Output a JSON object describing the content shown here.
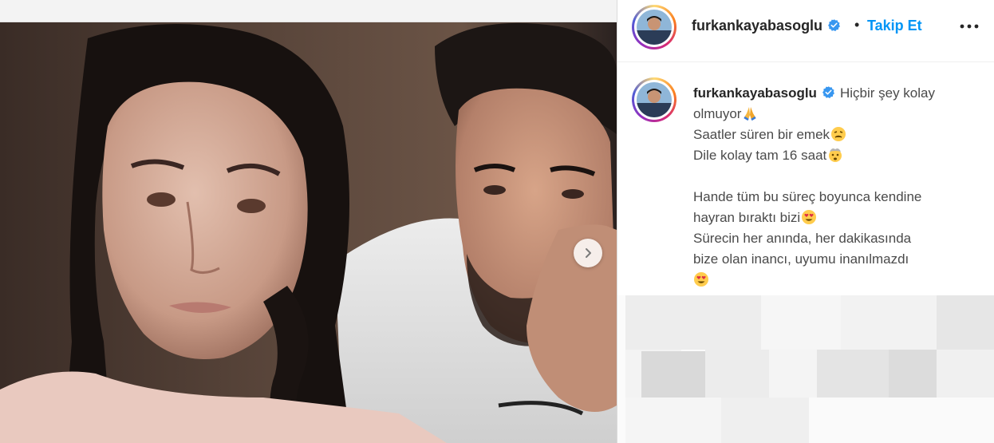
{
  "post": {
    "username": "furkankayabasoglu",
    "verified": true,
    "separator": "•",
    "follow_label": "Takip Et",
    "more_icon": "more-options-icon"
  },
  "caption": {
    "username": "furkankayabasoglu",
    "line1_text": "Hiçbir şey kolay",
    "line2_text": "olmuyor",
    "line2_emoji": "folded-hands-emoji",
    "line3_text": "Saatler süren bir emek",
    "line3_emoji": "weary-face-emoji",
    "line4_text": "Dile kolay tam 16 saat",
    "line4_emoji": "exploding-head-emoji",
    "line5_text": "Hande tüm bu süreç boyunca kendine",
    "line6_text": "hayran bıraktı bizi",
    "line6_emoji": "heart-eyes-emoji",
    "line7_text": "Sürecin her anında, her dakikasında",
    "line8_text": "bize olan inancı, uyumu inanılmazdı",
    "line9_emoji": "heart-eyes-emoji"
  },
  "colors": {
    "follow_blue": "#0095f6",
    "verified_blue": "#3897f0",
    "text_dark": "#262626",
    "caption_gray": "#4a4a4a"
  },
  "carousel": {
    "next_icon": "chevron-right-icon"
  }
}
